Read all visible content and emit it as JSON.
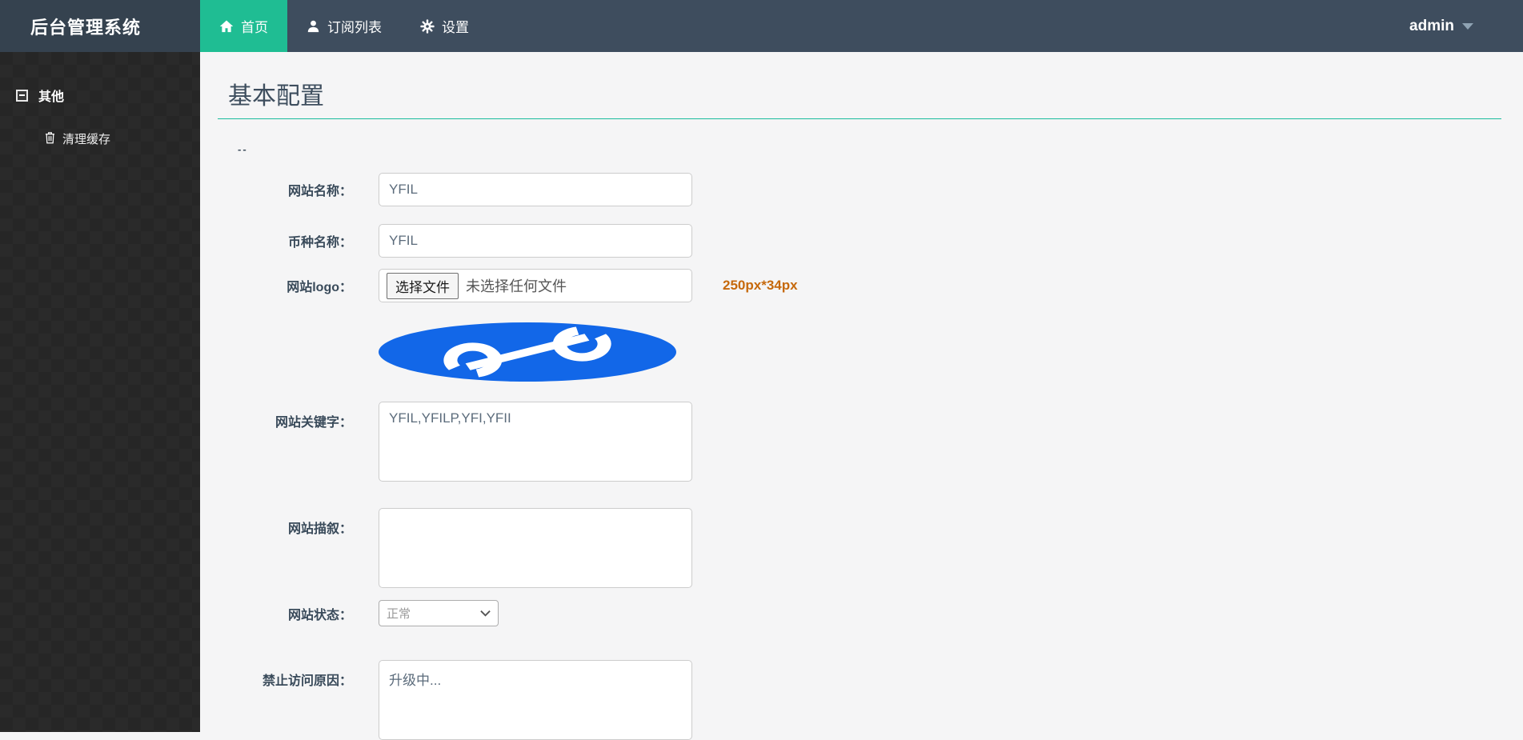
{
  "navbar": {
    "brand": "后台管理系统",
    "tabs": [
      {
        "label": "首页",
        "icon": "home-icon",
        "active": true
      },
      {
        "label": "订阅列表",
        "icon": "user-icon",
        "active": false
      },
      {
        "label": "设置",
        "icon": "gear-icon",
        "active": false
      }
    ],
    "user": {
      "name": "admin"
    }
  },
  "sidebar": {
    "group": {
      "label": "其他",
      "icon": "collapse-minus-icon"
    },
    "items": [
      {
        "label": "清理缓存",
        "icon": "trash-icon"
      }
    ]
  },
  "main": {
    "title": "基本配置",
    "note": "--",
    "form": {
      "site_name": {
        "label": "网站名称：",
        "value": "YFIL"
      },
      "coin_name": {
        "label": "币种名称：",
        "value": "YFIL"
      },
      "site_logo": {
        "label": "网站logo：",
        "button": "选择文件",
        "placeholder": "未选择任何文件",
        "hint": "250px*34px"
      },
      "keywords": {
        "label": "网站关键字：",
        "value": "YFIL,YFILP,YFI,YFII"
      },
      "description": {
        "label": "网站描叙：",
        "value": ""
      },
      "status": {
        "label": "网站状态：",
        "value": "正常"
      },
      "forbid_reason": {
        "label": "禁止访问原因：",
        "value": "升级中..."
      }
    }
  },
  "colors": {
    "navbar_bg": "#3e4d5e",
    "active_tab_green": "#1fbd93",
    "title_rule_teal": "#1abc9c",
    "hint_orange": "#c6690c",
    "logo_blue": "#1267e8",
    "sidebar_bg": "#262626"
  }
}
